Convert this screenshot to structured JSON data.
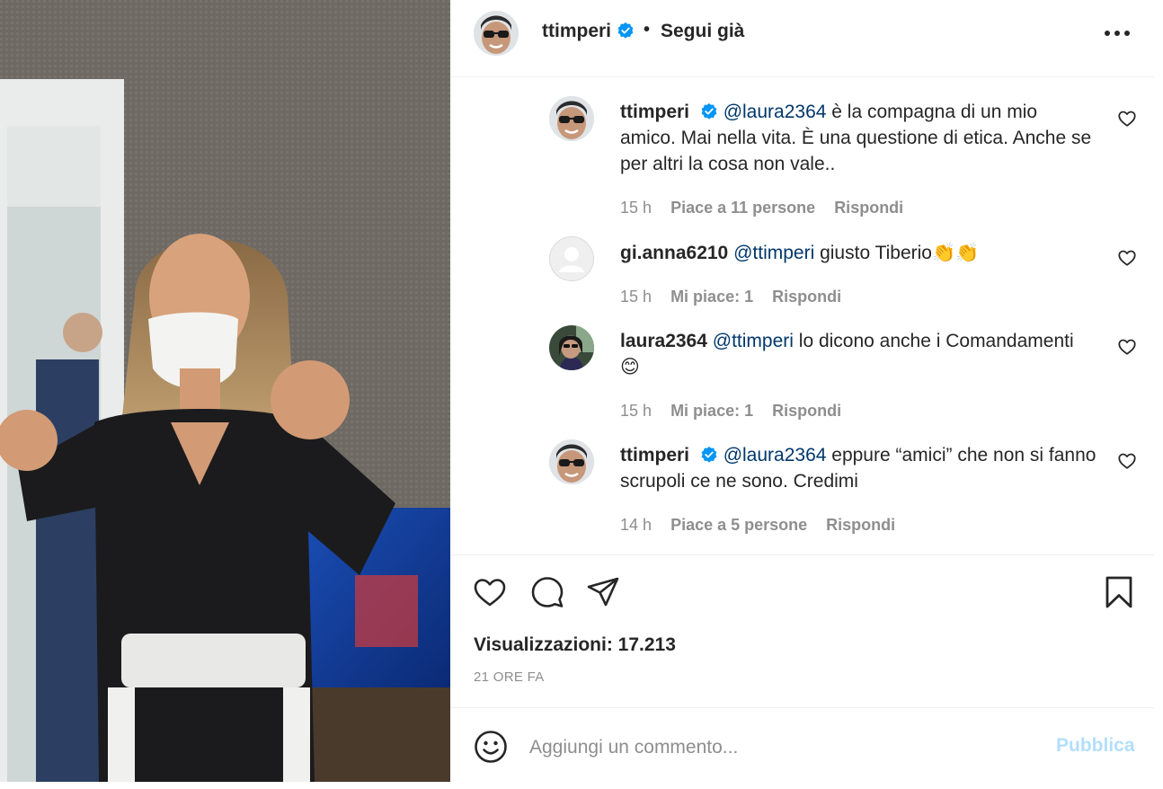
{
  "post": {
    "username": "ttimperi",
    "separator": "•",
    "follow_status": "Segui già",
    "more_icon": "more-horizontal-icon"
  },
  "comments": [
    {
      "username": "ttimperi",
      "verified": true,
      "mention": "@laura2364",
      "text": " è la compagna di un mio amico. Mai nella vita. È una questione di etica. Anche se per altri la cosa non vale..",
      "time": "15 h",
      "likes": "Piace a 11 persone",
      "reply": "Rispondi"
    },
    {
      "username": "gi.anna6210",
      "verified": false,
      "mention": "@ttimperi",
      "text": " giusto Tiberio👏👏",
      "time": "15 h",
      "likes": "Mi piace: 1",
      "reply": "Rispondi"
    },
    {
      "username": "laura2364",
      "verified": false,
      "mention": "@ttimperi",
      "text": " lo dicono anche i Comandamenti 😊",
      "time": "15 h",
      "likes": "Mi piace: 1",
      "reply": "Rispondi"
    },
    {
      "username": "ttimperi",
      "verified": true,
      "mention": "@laura2364",
      "text": " eppure “amici” che non si fanno scrupoli ce ne sono. Credimi",
      "time": "14 h",
      "likes": "Piace a 5 persone",
      "reply": "Rispondi"
    }
  ],
  "actions": {
    "like_icon": "heart-icon",
    "comment_icon": "comment-icon",
    "share_icon": "paper-plane-icon",
    "save_icon": "bookmark-icon"
  },
  "stats": {
    "views": "Visualizzazioni: 17.213",
    "time_ago": "21 ORE FA"
  },
  "composer": {
    "placeholder": "Aggiungi un commento...",
    "publish_label": "Pubblica",
    "emoji_icon": "emoji-smile-icon"
  },
  "colors": {
    "verified_blue": "#0095f6",
    "mention": "#00376b",
    "muted": "#8e8e8e",
    "publish_disabled": "#b2dffc"
  }
}
